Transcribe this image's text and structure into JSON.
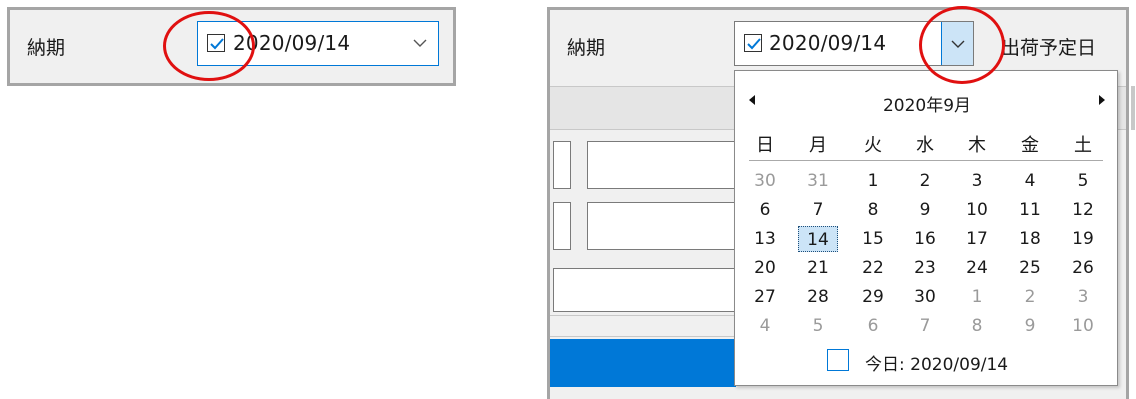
{
  "left": {
    "label": "納期",
    "date_value": "2020/09/14",
    "checked": true,
    "dropdown_icon": "chevron-down-icon"
  },
  "right": {
    "label": "納期",
    "date_value": "2020/09/14",
    "checked": true,
    "next_label": "出荷予定日",
    "dropdown_icon": "chevron-down-icon"
  },
  "calendar": {
    "month_title": "2020年9月",
    "prev_icon": "triangle-left-icon",
    "next_icon": "triangle-right-icon",
    "weekdays": [
      "日",
      "月",
      "火",
      "水",
      "木",
      "金",
      "土"
    ],
    "weeks": [
      [
        "30",
        "31",
        "1",
        "2",
        "3",
        "4",
        "5"
      ],
      [
        "6",
        "7",
        "8",
        "9",
        "10",
        "11",
        "12"
      ],
      [
        "13",
        "14",
        "15",
        "16",
        "17",
        "18",
        "19"
      ],
      [
        "20",
        "21",
        "22",
        "23",
        "24",
        "25",
        "26"
      ],
      [
        "27",
        "28",
        "29",
        "30",
        "1",
        "2",
        "3"
      ],
      [
        "4",
        "5",
        "6",
        "7",
        "8",
        "9",
        "10"
      ]
    ],
    "selected": "14",
    "today_label": "今日: 2020/09/14"
  },
  "colors": {
    "highlight_ring": "#e01010",
    "accent": "#0078d7",
    "selection_fill": "#cce4f7"
  }
}
